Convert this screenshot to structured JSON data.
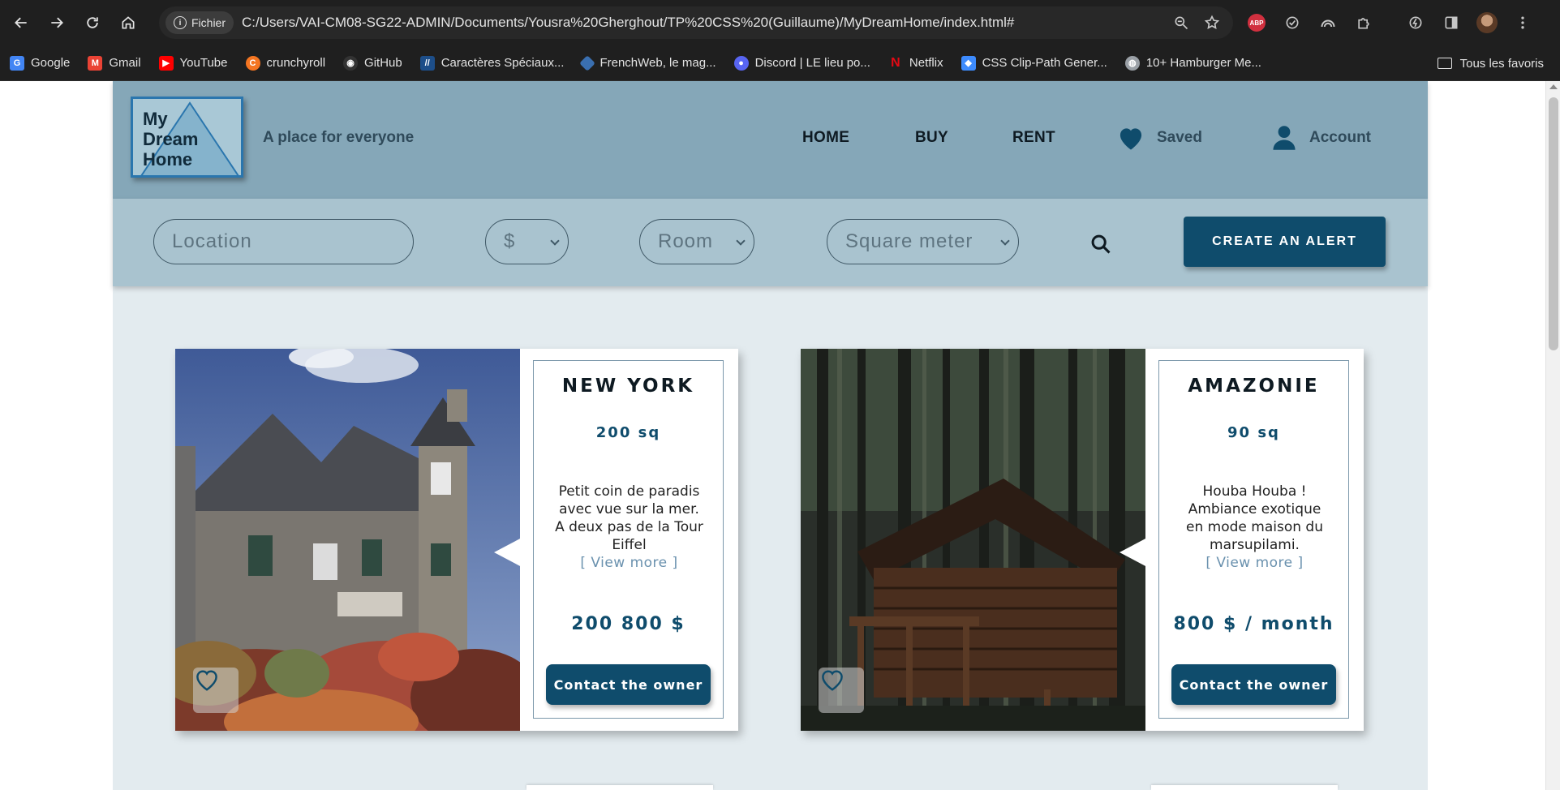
{
  "browser": {
    "chip_label": "Fichier",
    "url": "C:/Users/VAI-CM08-SG22-ADMIN/Documents/Yousra%20Gherghout/TP%20CSS%20(Guillaume)/MyDreamHome/index.html#",
    "abp_label": "ABP",
    "bookmarks": [
      {
        "label": "Google",
        "icon": "google-icon",
        "color": "#4285f4"
      },
      {
        "label": "Gmail",
        "icon": "gmail-icon",
        "color": "#ea4335"
      },
      {
        "label": "YouTube",
        "icon": "youtube-icon",
        "color": "#ff0000"
      },
      {
        "label": "crunchyroll",
        "icon": "crunchyroll-icon",
        "color": "#f47521"
      },
      {
        "label": "GitHub",
        "icon": "github-icon",
        "color": "#333333"
      },
      {
        "label": "Caractères Spéciaux...",
        "icon": "special-chars-icon",
        "color": "#1d4e89"
      },
      {
        "label": "FrenchWeb, le mag...",
        "icon": "frenchweb-icon",
        "color": "#3a6fb0"
      },
      {
        "label": "Discord | LE lieu po...",
        "icon": "discord-icon",
        "color": "#5865f2"
      },
      {
        "label": "Netflix",
        "icon": "netflix-icon",
        "color": "#e50914"
      },
      {
        "label": "CSS Clip-Path Gener...",
        "icon": "clippy-icon",
        "color": "#3d8bfd"
      },
      {
        "label": "10+ Hamburger Me...",
        "icon": "globe-icon",
        "color": "#9aa0a6"
      }
    ],
    "all_bookmarks": "Tous les favoris"
  },
  "site": {
    "logo_lines": [
      "My",
      "Dream",
      "Home"
    ],
    "tagline": "A place for everyone",
    "nav": {
      "home": "HOME",
      "buy": "BUY",
      "rent": "RENT",
      "saved": "Saved",
      "account": "Account"
    },
    "search": {
      "location_placeholder": "Location",
      "price_select": "$",
      "room_select": "Room",
      "square_select": "Square meter",
      "alert_button": "CREATE AN ALERT"
    },
    "listings": [
      {
        "city": "NEW YORK",
        "size": "200 sq",
        "description": "Petit coin de paradis avec vue sur la mer. A deux pas de la Tour Eiffel",
        "view_more": "[ View more ]",
        "price": "200 800 $",
        "contact": "Contact the owner"
      },
      {
        "city": "AMAZONIE",
        "size": "90 sq",
        "description": "Houba Houba ! Ambiance exotique en mode maison du marsupilami.",
        "view_more": "[ View more ]",
        "price": "800 $ / month",
        "contact": "Contact the owner"
      }
    ]
  },
  "colors": {
    "header": "#85a7b8",
    "searchbar": "#a9c3cf",
    "page_bg": "#e3ebef",
    "accent": "#0f4c6c"
  }
}
